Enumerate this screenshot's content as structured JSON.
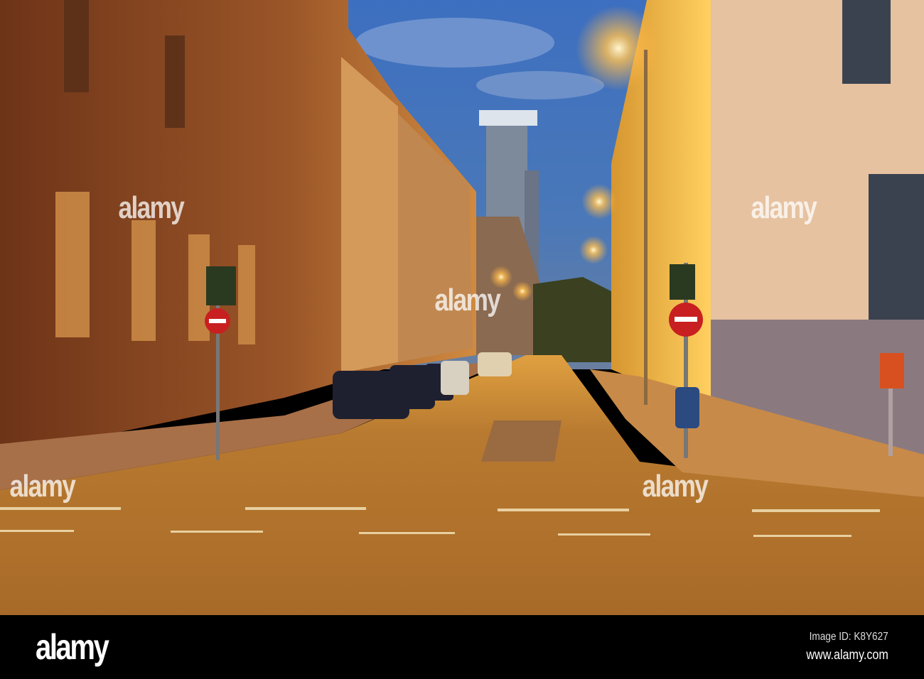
{
  "watermark": {
    "logo_text": "alamy"
  },
  "footer": {
    "logo": "alamy",
    "image_id": "Image ID: K8Y627",
    "url": "www.alamy.com"
  },
  "colors": {
    "sky": "#3f6fb8",
    "lamp": "#ffb84a",
    "road": "#b8772e",
    "facade_left": "#8a4a24",
    "facade_right": "#e8a534"
  }
}
